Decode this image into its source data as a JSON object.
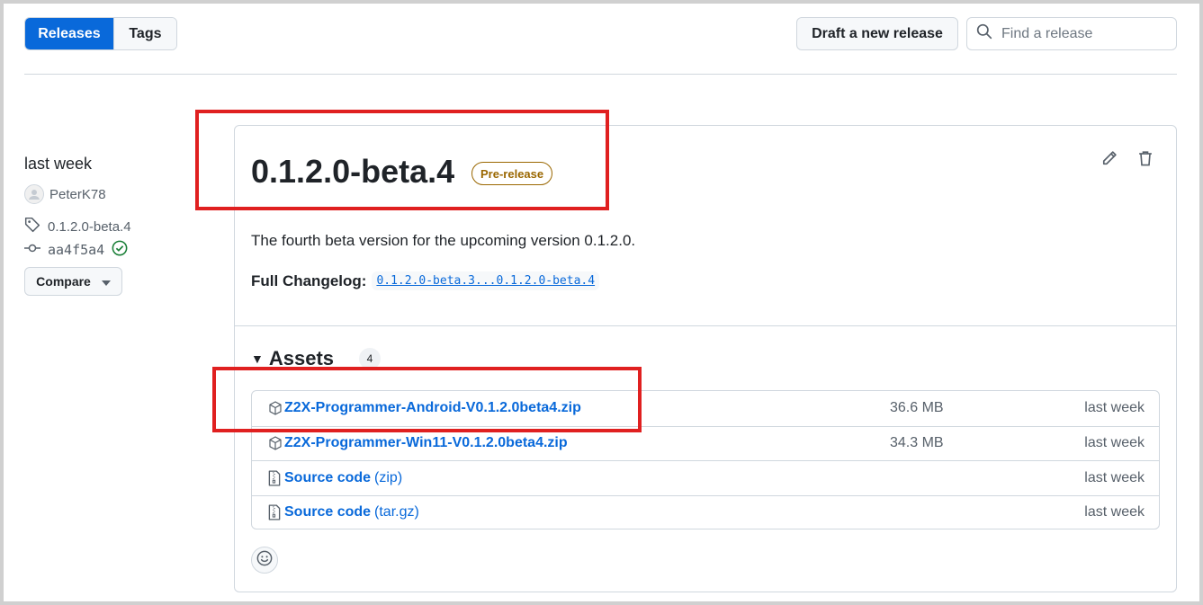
{
  "toolbar": {
    "tabs": [
      {
        "label": "Releases",
        "active": true
      },
      {
        "label": "Tags",
        "active": false
      }
    ],
    "draft_label": "Draft a new release",
    "search_placeholder": "Find a release"
  },
  "meta": {
    "date": "last week",
    "author": "PeterK78",
    "tag": "0.1.2.0-beta.4",
    "commit": "aa4f5a4",
    "compare_label": "Compare"
  },
  "release": {
    "title": "0.1.2.0-beta.4",
    "badge": "Pre-release",
    "description": "The fourth beta version for the upcoming version 0.1.2.0.",
    "changelog_label": "Full Changelog:",
    "changelog_link": "0.1.2.0-beta.3...0.1.2.0-beta.4"
  },
  "assets": {
    "heading": "Assets",
    "count": "4",
    "items": [
      {
        "name": "Z2X-Programmer-Android-V0.1.2.0beta4.zip",
        "suffix": "",
        "size": "36.6 MB",
        "when": "last week",
        "icon": "package-icon"
      },
      {
        "name": "Z2X-Programmer-Win11-V0.1.2.0beta4.zip",
        "suffix": "",
        "size": "34.3 MB",
        "when": "last week",
        "icon": "package-icon"
      },
      {
        "name": "Source code",
        "suffix": "(zip)",
        "size": "",
        "when": "last week",
        "icon": "file-zip-icon"
      },
      {
        "name": "Source code",
        "suffix": "(tar.gz)",
        "size": "",
        "when": "last week",
        "icon": "file-zip-icon"
      }
    ]
  },
  "colors": {
    "accent": "#0969da",
    "prerelease": "#9a6700",
    "highlight": "#e02020",
    "verified": "#1a7f37"
  }
}
